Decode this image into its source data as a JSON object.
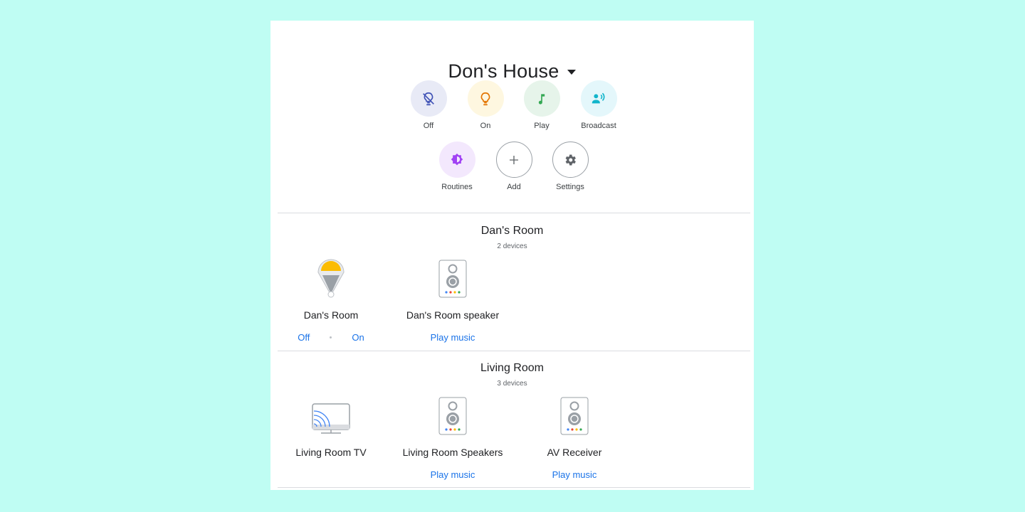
{
  "header": {
    "home_name": "Don's House"
  },
  "quick_actions": [
    {
      "label": "Off",
      "icon": "light-off-icon",
      "bg": "#e8eaf6",
      "fg": "#3f51b5"
    },
    {
      "label": "On",
      "icon": "lightbulb-icon",
      "bg": "#fef7e0",
      "fg": "#e37400"
    },
    {
      "label": "Play",
      "icon": "music-note-icon",
      "bg": "#e6f4ea",
      "fg": "#34a853"
    },
    {
      "label": "Broadcast",
      "icon": "broadcast-icon",
      "bg": "#e4f7fb",
      "fg": "#12b5cb"
    },
    {
      "label": "Routines",
      "icon": "routines-icon",
      "bg": "#f3e8fd",
      "fg": "#a142f4"
    },
    {
      "label": "Add",
      "icon": "plus-icon",
      "bg": "#ffffff",
      "fg": "#5f6368"
    },
    {
      "label": "Settings",
      "icon": "gear-icon",
      "bg": "#ffffff",
      "fg": "#5f6368"
    }
  ],
  "rooms": [
    {
      "name": "Dan's Room",
      "count": "2 devices",
      "devices": [
        {
          "name": "Dan's Room",
          "icon": "lamp-icon",
          "actions": [
            "Off",
            "On"
          ]
        },
        {
          "name": "Dan's Room speaker",
          "icon": "speaker-icon",
          "actions": [
            "Play music"
          ]
        }
      ]
    },
    {
      "name": "Living Room",
      "count": "3 devices",
      "devices": [
        {
          "name": "Living Room TV",
          "icon": "tv-cast-icon",
          "actions": []
        },
        {
          "name": "Living Room Speakers",
          "icon": "speaker-icon",
          "actions": [
            "Play music"
          ]
        },
        {
          "name": "AV Receiver",
          "icon": "speaker-icon",
          "actions": [
            "Play music"
          ]
        }
      ]
    }
  ],
  "colors": {
    "background": "#bffdf3",
    "link": "#1a73e8",
    "lamp_shade": "#fbbc04",
    "speaker_dots": [
      "#4285f4",
      "#ea4335",
      "#fbbc04",
      "#34a853"
    ]
  }
}
